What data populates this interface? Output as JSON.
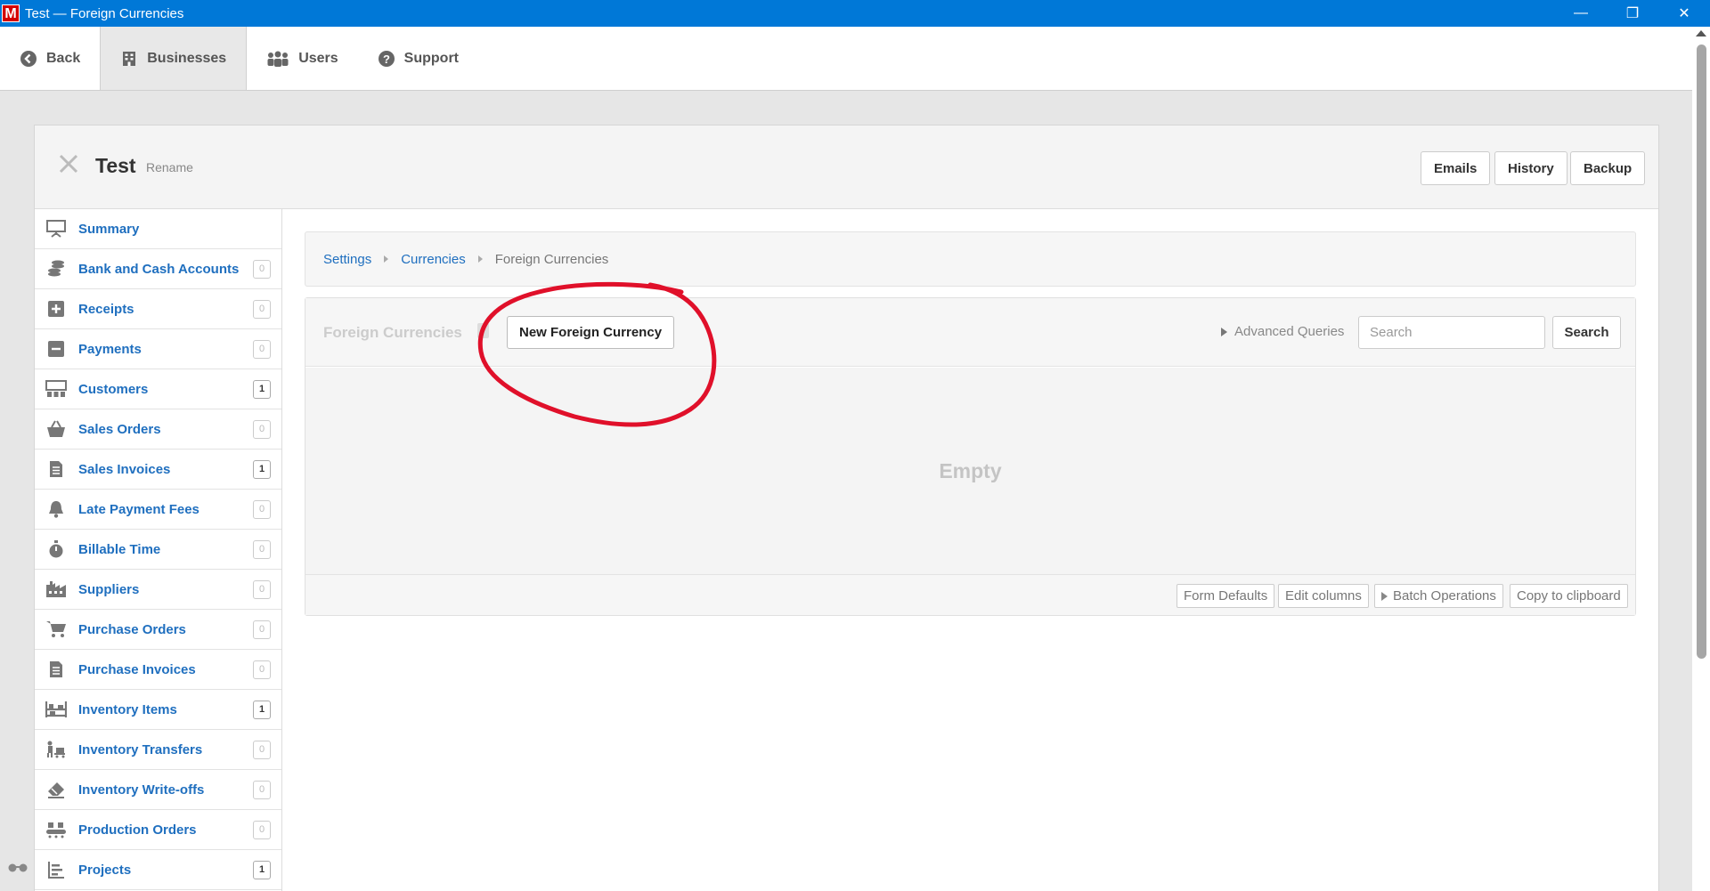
{
  "window": {
    "logo_letter": "M",
    "title": "Test — Foreign Currencies",
    "minimize": "—",
    "maximize": "❐",
    "close": "✕"
  },
  "nav": {
    "items": [
      {
        "label": "Back",
        "icon": "back-arrow-icon"
      },
      {
        "label": "Businesses",
        "icon": "building-icon",
        "active": true
      },
      {
        "label": "Users",
        "icon": "users-icon"
      },
      {
        "label": "Support",
        "icon": "question-icon"
      }
    ]
  },
  "business": {
    "name": "Test",
    "rename": "Rename",
    "buttons": {
      "emails": "Emails",
      "history": "History",
      "backup": "Backup"
    }
  },
  "sidebar": {
    "items": [
      {
        "label": "Summary",
        "icon": "presentation-icon",
        "count": null
      },
      {
        "label": "Bank and Cash Accounts",
        "icon": "coins-icon",
        "count": "0"
      },
      {
        "label": "Receipts",
        "icon": "plus-square-icon",
        "count": "0"
      },
      {
        "label": "Payments",
        "icon": "minus-square-icon",
        "count": "0"
      },
      {
        "label": "Customers",
        "icon": "customers-icon",
        "count": "1"
      },
      {
        "label": "Sales Orders",
        "icon": "basket-icon",
        "count": "0"
      },
      {
        "label": "Sales Invoices",
        "icon": "document-icon",
        "count": "1"
      },
      {
        "label": "Late Payment Fees",
        "icon": "bell-icon",
        "count": "0"
      },
      {
        "label": "Billable Time",
        "icon": "stopwatch-icon",
        "count": "0"
      },
      {
        "label": "Suppliers",
        "icon": "factory-icon",
        "count": "0"
      },
      {
        "label": "Purchase Orders",
        "icon": "cart-icon",
        "count": "0"
      },
      {
        "label": "Purchase Invoices",
        "icon": "document-icon",
        "count": "0"
      },
      {
        "label": "Inventory Items",
        "icon": "shelf-icon",
        "count": "1"
      },
      {
        "label": "Inventory Transfers",
        "icon": "forklift-icon",
        "count": "0"
      },
      {
        "label": "Inventory Write-offs",
        "icon": "eraser-icon",
        "count": "0"
      },
      {
        "label": "Production Orders",
        "icon": "conveyor-icon",
        "count": "0"
      },
      {
        "label": "Projects",
        "icon": "bar-chart-icon",
        "count": "1"
      }
    ]
  },
  "breadcrumb": {
    "settings": "Settings",
    "currencies": "Currencies",
    "current": "Foreign Currencies"
  },
  "list": {
    "title": "Foreign Currencies",
    "new_button": "New Foreign Currency",
    "advanced_queries": "Advanced Queries",
    "search_placeholder": "Search",
    "search_button": "Search",
    "empty": "Empty",
    "footer": {
      "form_defaults": "Form Defaults",
      "edit_columns": "Edit columns",
      "batch_operations": "Batch Operations",
      "copy_clipboard": "Copy to clipboard"
    }
  },
  "colors": {
    "titlebar": "#0078d7",
    "link": "#1f6fbf",
    "annotation": "#e0102a"
  }
}
